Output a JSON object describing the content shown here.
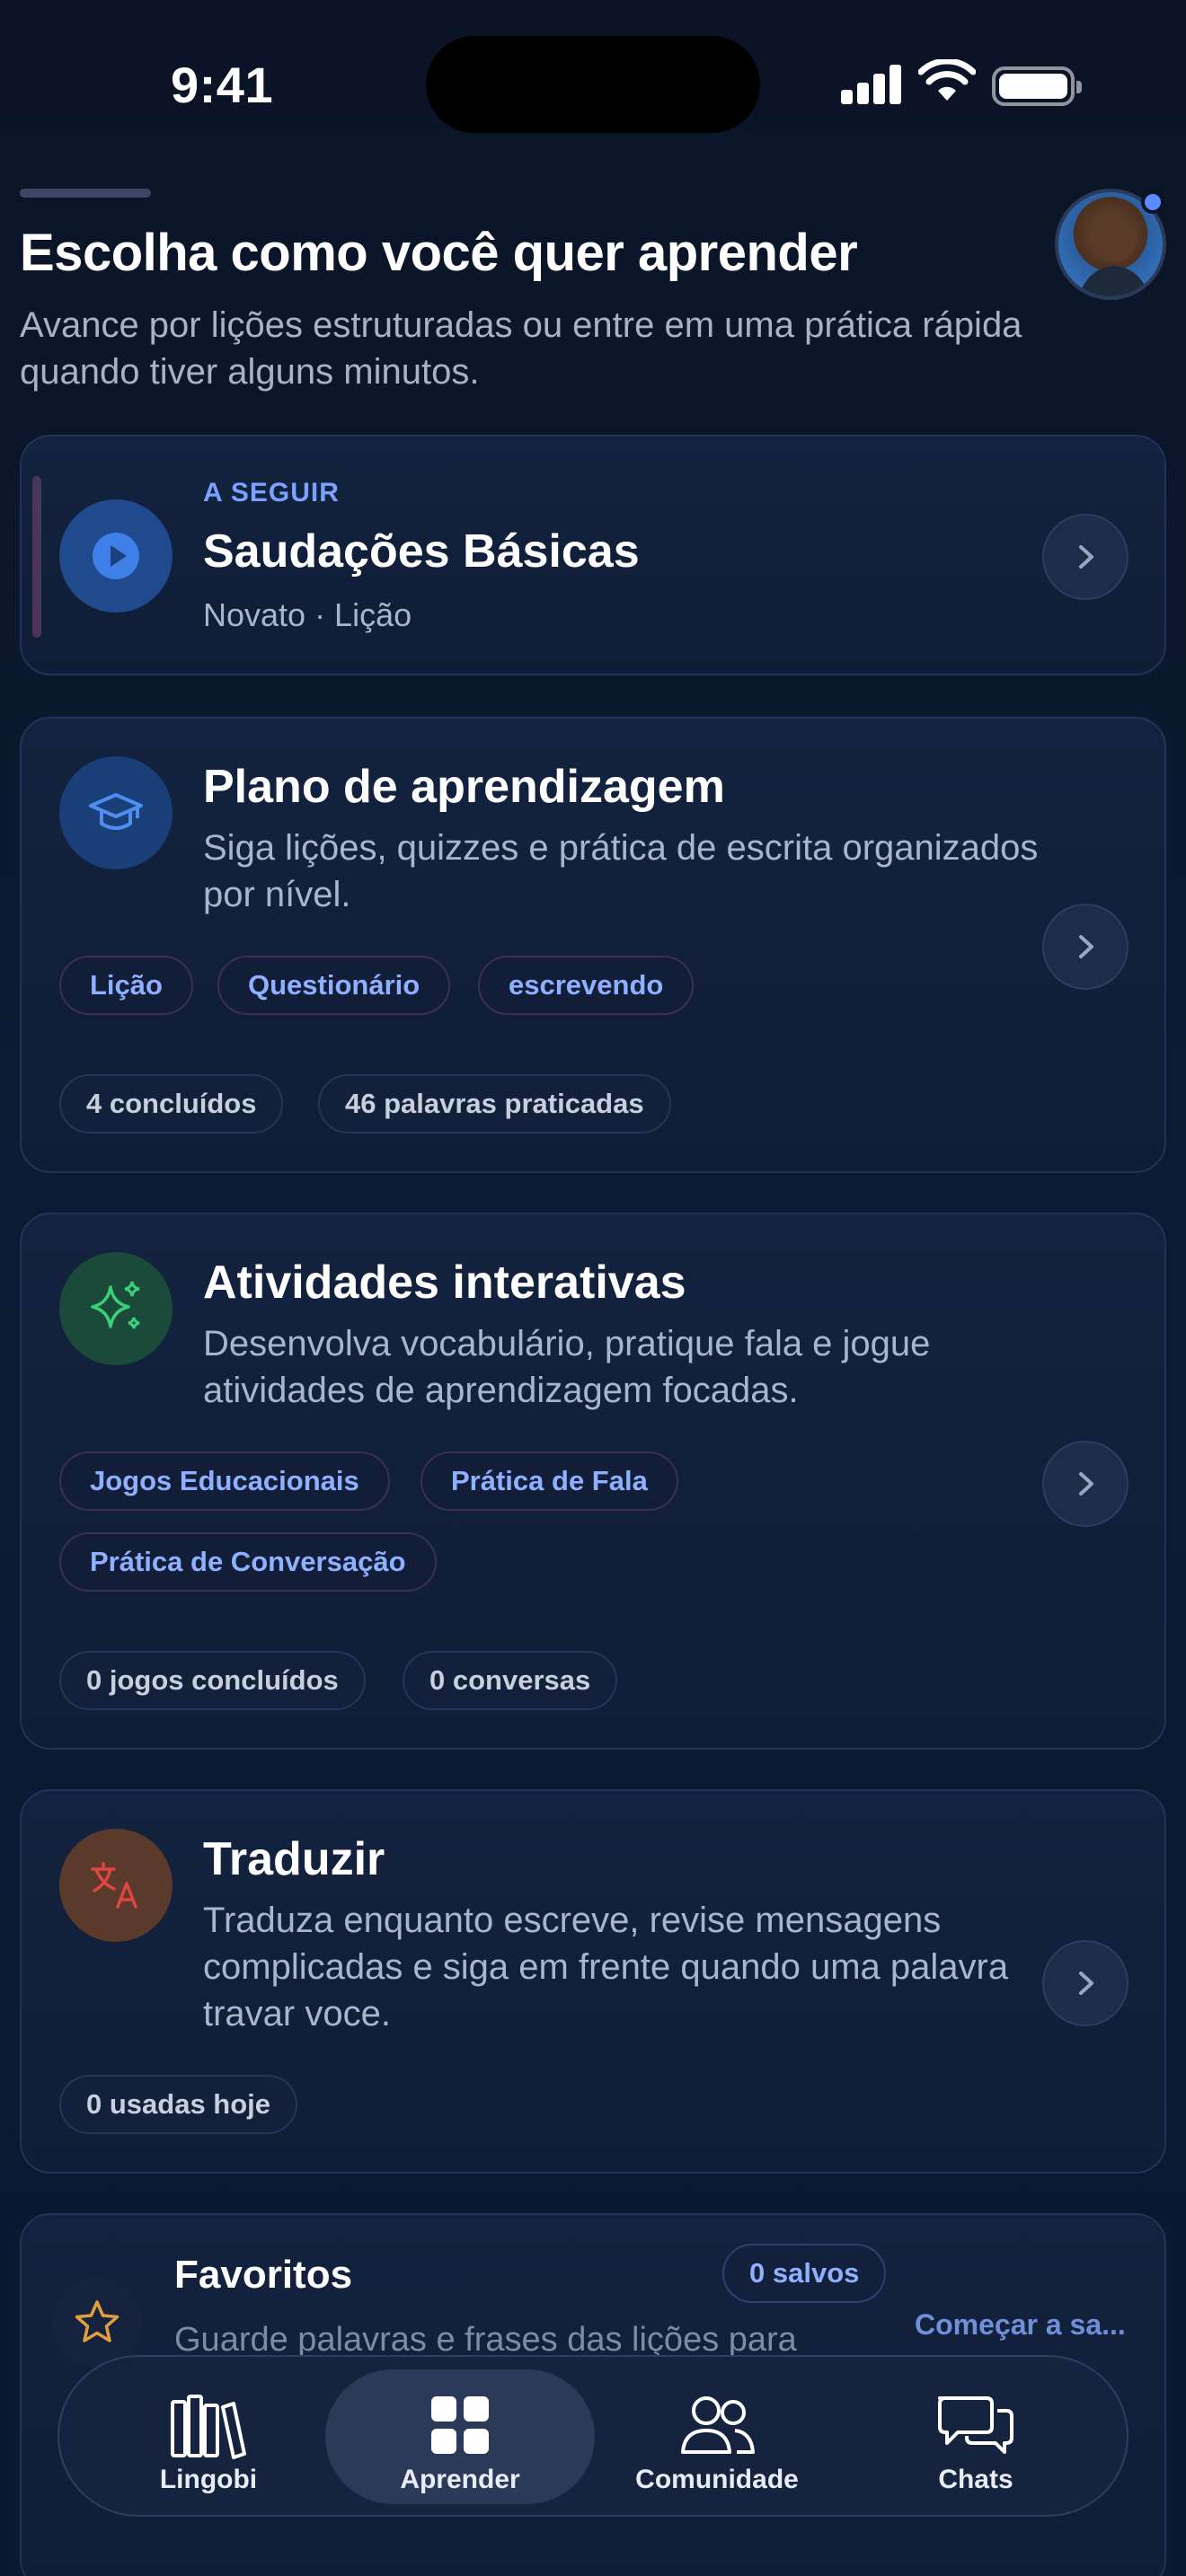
{
  "status_bar": {
    "time": "9:41"
  },
  "header": {
    "title": "Escolha como você quer aprender",
    "subtitle": "Avance por lições estruturadas ou entre em uma prática rápida quando tiver alguns minutos."
  },
  "next_up": {
    "eyebrow": "A SEGUIR",
    "title": "Saudações Básicas",
    "meta": "Novato · Lição"
  },
  "learning_plan": {
    "title": "Plano de aprendizagem",
    "description": "Siga lições, quizzes e prática de escrita organizados por nível.",
    "chips": [
      "Lição",
      "Questionário",
      "escrevendo"
    ],
    "stats": [
      "4 concluídos",
      "46 palavras praticadas"
    ]
  },
  "interactive": {
    "title": "Atividades interativas",
    "description": "Desenvolva vocabulário, pratique fala e jogue atividades de aprendizagem focadas.",
    "chips": [
      "Jogos Educacionais",
      "Prática de Fala",
      "Prática de Conversação"
    ],
    "stats": [
      "0 jogos concluídos",
      "0 conversas"
    ]
  },
  "translate": {
    "title": "Traduzir",
    "description": "Traduza enquanto escreve, revise mensagens complicadas e siga em frente quando uma palavra travar voce.",
    "stats": [
      "0 usadas hoje"
    ]
  },
  "favorites": {
    "title": "Favoritos",
    "badge": "0 salvos",
    "description": "Guarde palavras e frases das lições para",
    "action": "Começar a sa..."
  },
  "tab_bar": {
    "tabs": [
      {
        "label": "Lingobi",
        "icon": "books-icon"
      },
      {
        "label": "Aprender",
        "icon": "grid-icon"
      },
      {
        "label": "Comunidade",
        "icon": "people-icon"
      },
      {
        "label": "Chats",
        "icon": "chat-bubbles-icon"
      }
    ],
    "active_index": 1
  },
  "colors": {
    "background": "#0b1426",
    "card": "#13223e",
    "accent_blue": "#8fb0ff",
    "eyebrow_blue": "#7aa2ff",
    "translate_red": "#e0453f",
    "favorites_star": "#e0a040",
    "sparkle_green": "#3ad07a"
  }
}
